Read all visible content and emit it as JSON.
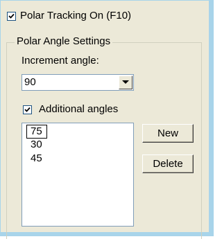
{
  "polar_tracking": {
    "label": "Polar Tracking On (F10)",
    "checked": true
  },
  "polar_angle_settings": {
    "title": "Polar Angle Settings",
    "increment_angle": {
      "label": "Increment angle:",
      "value": "90"
    },
    "additional_angles": {
      "label": "Additional angles",
      "checked": true,
      "items": [
        "75",
        "30",
        "45"
      ]
    },
    "buttons": {
      "new_label": "New",
      "delete_label": "Delete"
    }
  },
  "icons": [
    "checkmark-icon",
    "chevron-down-icon"
  ],
  "colors": {
    "panel_background": "#ece9d8",
    "outer_frame": "#a8d4ea",
    "field_border": "#7f9db9",
    "checkbox_border": "#1c5180"
  }
}
